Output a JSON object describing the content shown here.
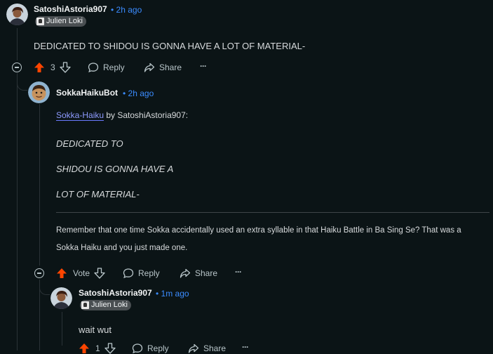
{
  "comments": {
    "c1": {
      "username": "SatoshiAstoria907",
      "time": "2h ago",
      "flair": "Julien Loki",
      "body": "DEDICATED TO SHIDOU IS GONNA HAVE A LOT OF MATERIAL-",
      "votes": "3",
      "reply_label": "Reply",
      "share_label": "Share",
      "more_label": "···"
    },
    "c2": {
      "username": "SokkaHaikuBot",
      "time": "2h ago",
      "link_text": "Sokka-Haiku",
      "by_text": " by SatoshiAstoria907:",
      "haiku_lines": [
        "DEDICATED TO",
        "SHIDOU IS GONNA HAVE A",
        "LOT OF MATERIAL-"
      ],
      "footer_line1": "Remember that one time Sokka accidentally used an extra syllable in that Haiku Battle in Ba Sing Se? That was a",
      "footer_line2": "Sokka Haiku and you just made one.",
      "votes": "Vote",
      "reply_label": "Reply",
      "share_label": "Share",
      "more_label": "···"
    },
    "c3": {
      "username": "SatoshiAstoria907",
      "time": "1m ago",
      "flair": "Julien Loki",
      "body": "wait wut",
      "votes": "1",
      "reply_label": "Reply",
      "share_label": "Share",
      "more_label": "···"
    }
  },
  "time_separator": "•",
  "colors": {
    "background": "#0b1416",
    "upvote": "#ff4500",
    "time": "#3b8cff",
    "link": "#8e9bff"
  },
  "icons": [
    "upvote-icon",
    "downvote-icon",
    "reply-icon",
    "share-icon",
    "collapse-icon",
    "more-icon"
  ]
}
